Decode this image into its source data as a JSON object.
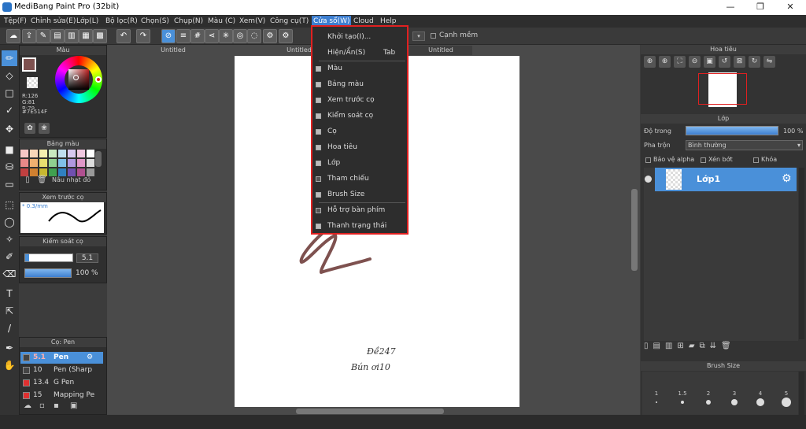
{
  "window": {
    "title": "MediBang Paint Pro (32bit)",
    "minimize": "—",
    "maximize": "❐",
    "close": "✕"
  },
  "menubar": {
    "items": [
      "Tệp(F)",
      "Chỉnh sửa(E)",
      "Lớp(L)",
      "Bộ lọc(R)",
      "Chọn(S)",
      "Chụp(N)",
      "Màu (C)",
      "Xem(V)",
      "Công cụ(T)",
      "Cửa sổ(W)",
      "Cloud",
      "Help"
    ],
    "active_index": 9
  },
  "toolbar": {
    "antialias_label": "Cạnh mềm"
  },
  "doc_tabs": [
    "Untitled",
    "Untitled",
    "Untitled"
  ],
  "window_menu": {
    "items": [
      {
        "label": "Khởi tạo(I)...",
        "checkbox": false
      },
      {
        "label": "Hiện/Ẩn(S)",
        "shortcut": "Tab",
        "checkbox": false
      },
      {
        "label": "Màu",
        "checkbox": true,
        "checked": true
      },
      {
        "label": "Bảng màu",
        "checkbox": true,
        "checked": true
      },
      {
        "label": "Xem trước cọ",
        "checkbox": true,
        "checked": true
      },
      {
        "label": "Kiểm soát cọ",
        "checkbox": true,
        "checked": true
      },
      {
        "label": "Cọ",
        "checkbox": true,
        "checked": true
      },
      {
        "label": "Hoa tiêu",
        "checkbox": true,
        "checked": true
      },
      {
        "label": "Lớp",
        "checkbox": true,
        "checked": true
      },
      {
        "label": "Tham chiếu",
        "checkbox": true,
        "checked": false
      },
      {
        "label": "Brush Size",
        "checkbox": true,
        "checked": true
      },
      {
        "label": "Hỗ trợ bàn phím",
        "checkbox": true,
        "checked": false
      },
      {
        "label": "Thanh trạng thái",
        "checkbox": true,
        "checked": true
      }
    ]
  },
  "color_panel": {
    "title": "Màu",
    "r": "R:126",
    "g": "G:81",
    "b": "B:79",
    "hex": "#7E514F",
    "primary_color": "#7E514F"
  },
  "palette_panel": {
    "title": "Bảng màu",
    "selected_name": "Nâu nhạt đỏ",
    "swatches": [
      "#f5c6c6",
      "#f8d6b8",
      "#f6f0b0",
      "#c8e8c0",
      "#c0dff0",
      "#d8c8f0",
      "#f0c8e0",
      "#ffffff",
      "#e88888",
      "#f0b070",
      "#e8e070",
      "#90d090",
      "#80c0e8",
      "#b098e0",
      "#e098c8",
      "#dddddd",
      "#c04040",
      "#d08030",
      "#c8b830",
      "#40a050",
      "#3080c0",
      "#7050b0",
      "#b05090",
      "#999999"
    ]
  },
  "brush_preview_panel": {
    "title": "Xem trước cọ",
    "size_text": "* 0.3/mm"
  },
  "brush_control_panel": {
    "title": "Kiểm soát cọ",
    "size_value": "5.1",
    "opacity_value": "100 %",
    "opacity_fraction": 1.0
  },
  "brush_panel": {
    "title": "Cọ: Pen",
    "items": [
      {
        "size": "5.1",
        "name": "Pen",
        "selected": true,
        "color": "#444444"
      },
      {
        "size": "10",
        "name": "Pen (Sharp",
        "selected": false,
        "color": "#444444"
      },
      {
        "size": "13.4",
        "name": "G Pen",
        "selected": false,
        "color": "#e03030"
      },
      {
        "size": "15",
        "name": "Mapping Pe",
        "selected": false,
        "color": "#e03030"
      }
    ]
  },
  "navigator_panel": {
    "title": "Hoa tiêu"
  },
  "layer_panel": {
    "title": "Lớp",
    "opacity_label": "Độ trong",
    "opacity_value": "100 %",
    "opacity_fraction": 1.0,
    "blend_label": "Pha trộn",
    "blend_value": "Bình thường",
    "protect_alpha": "Bảo vệ alpha",
    "clipping": "Xén bớt",
    "lock": "Khóa",
    "layer_name": "Lớp1"
  },
  "brush_size_panel": {
    "title": "Brush Size",
    "sizes": [
      "1",
      "1.5",
      "2",
      "3",
      "4",
      "5"
    ]
  },
  "canvas": {
    "handwriting_line1": "Đề247",
    "handwriting_line2": "Bún ơi10"
  },
  "colors": {
    "accent": "#4a90d9",
    "highlight_border": "#e02020",
    "stroke": "#7E514F"
  }
}
